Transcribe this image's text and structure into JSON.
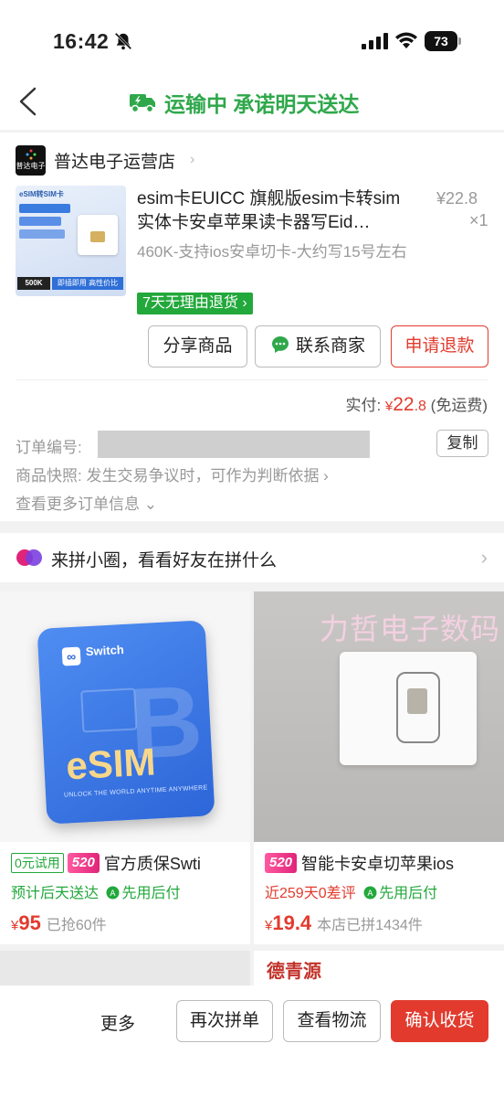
{
  "status_bar": {
    "time": "16:42",
    "battery": "73"
  },
  "nav": {
    "title": "运输中 承诺明天送达"
  },
  "shop": {
    "name": "普达电子运营店",
    "logo_text": "普达电子"
  },
  "product": {
    "title": "esim卡EUICC 旗舰版esim卡转sim实体卡安卓苹果读卡器写Eid…",
    "price": "¥22.8",
    "qty": "×1",
    "spec": "460K-支持ios安卓切卡-大约写15号左右",
    "return_badge": "7天无理由退货 ›",
    "thumb_texts": [
      "eSIM转SIM卡",
      "500K",
      "即插即用 高性价比"
    ]
  },
  "actions": {
    "share": "分享商品",
    "contact": "联系商家",
    "refund": "申请退款"
  },
  "payment": {
    "label": "实付: ",
    "yen": "¥",
    "amount": "22",
    "decimal": ".8",
    "note": " (免运费)"
  },
  "order": {
    "number_label": "订单编号:",
    "copy": "复制",
    "snapshot": "商品快照:  发生交易争议时，可作为判断依据 ›",
    "more": "查看更多订单信息 ⌄"
  },
  "circle": {
    "text": "来拼小圈，看看好友在拼什么"
  },
  "recommendations": [
    {
      "tag_free": "0元试用",
      "tag_520": "520",
      "title": "官方质保Swti",
      "sub_main": "预计后天送达",
      "sub_paylater": "先用后付",
      "price_yen": "¥",
      "price": "95",
      "sold": "已抢60件",
      "card_brand": "Switch",
      "card_main": "eSIM",
      "card_slogan": "UNLOCK THE WORLD ANYTIME ANYWHERE"
    },
    {
      "tag_520": "520",
      "title": "智能卡安卓切苹果ios",
      "sub_main": "近259天0差评",
      "sub_paylater": "先用后付",
      "price_yen": "¥",
      "price": "19.4",
      "sold": "本店已拼1434件",
      "watermark": "力哲电子数码"
    }
  ],
  "rec4_brand": "德青源",
  "bottom_bar": {
    "more": "更多",
    "rebuy": "再次拼单",
    "logistics": "查看物流",
    "confirm": "确认收货"
  },
  "colors": {
    "green": "#2fa84b",
    "red": "#e23b2e",
    "pink": "#e0247a"
  }
}
